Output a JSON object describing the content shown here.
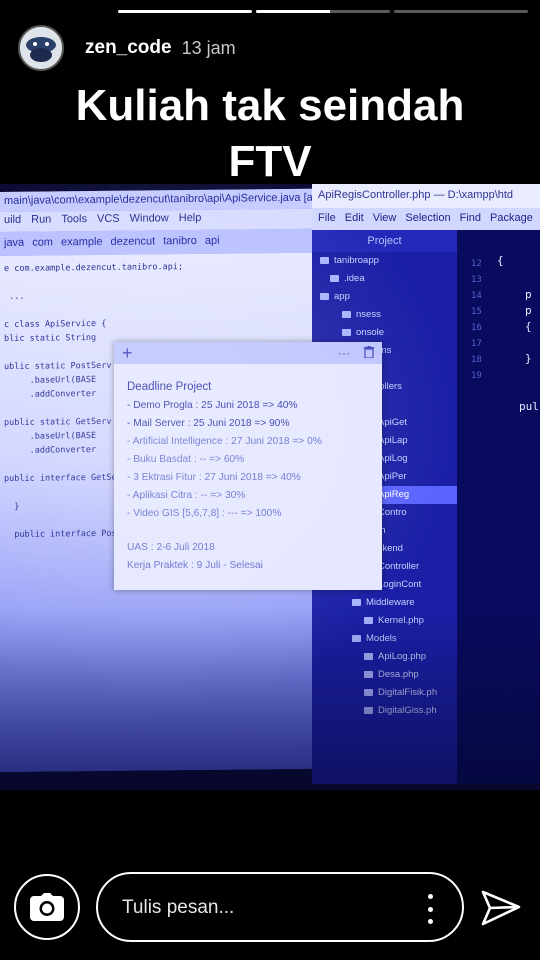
{
  "story": {
    "progress": [
      1.0,
      0.55,
      0.0
    ]
  },
  "header": {
    "username": "zen_code",
    "timestamp": "13 jam"
  },
  "caption": {
    "line1": "Kuliah tak seindah",
    "line2": "FTV"
  },
  "screen": {
    "ide_left": {
      "path": "main\\java\\com\\example\\dezencut\\tanibro\\api\\ApiService.java [ap",
      "menu": [
        "uild",
        "Run",
        "Tools",
        "VCS",
        "Window",
        "Help"
      ],
      "crumbs": [
        "java",
        "com",
        "example",
        "dezencut",
        "tanibro",
        "api"
      ],
      "code_lines": [
        "e com.example.dezencut.tanibro.api;",
        "",
        " ...",
        "",
        "c class ApiService {",
        "blic static String",
        "",
        "ublic static PostServ",
        "     .baseUrl(BASE",
        "     .addConverter",
        "",
        "public static GetServ",
        "     .baseUrl(BASE",
        "     .addConverter",
        "",
        "public interface GetSe",
        "",
        "  }",
        "",
        "  public interface Post"
      ]
    },
    "ide_right": {
      "title": "ApiRegisController.php — D:\\xampp\\htd",
      "menu": [
        "File",
        "Edit",
        "View",
        "Selection",
        "Find",
        "Package"
      ],
      "project_label": "Project",
      "tree": [
        "tanibroapp",
        ".idea",
        "app",
        "nsess",
        "onsole",
        "ceptions",
        "tp",
        "Controllers",
        "Api",
        "ApiGet",
        "ApiLap",
        "ApiLog",
        "ApiPer",
        "ApiReg",
        "Contro",
        "Auth",
        "Backend",
        "Controller",
        "LoginCont",
        "Middleware",
        "Kernel.php",
        "Models",
        "ApiLog.php",
        "Desa.php",
        "DigitalFisik.ph",
        "DigitalGiss.ph"
      ],
      "selected_index": 13,
      "gutter": "12\n13\n14\n15\n16\n17\n18\n19",
      "tokens": [
        "{",
        "p",
        "p",
        "{",
        "}",
        "pul"
      ]
    },
    "note": {
      "title": "Deadline Project",
      "items": [
        "- Demo Progla : 25 Juni 2018  => 40%",
        "- Mail Server : 25 Juni 2018 => 90%",
        "- Artificial Intelligence : 27 Juni 2018 => 0%",
        "- Buku Basdat : -- => 60%",
        "- 3 Ektrasi Fitur : 27 Juni 2018 => 40%",
        "- Aplikasi Citra : -- => 30%",
        "- Video GIS [5,6,7,8] : --- => 100%"
      ],
      "footer1": "UAS : 2-6 Juli 2018",
      "footer2": "Kerja Praktek : 9 Juli - Selesai"
    }
  },
  "composer": {
    "placeholder": "Tulis pesan..."
  },
  "icons": {
    "camera": "camera-icon",
    "more": "more-vertical-icon",
    "send": "send-icon"
  }
}
